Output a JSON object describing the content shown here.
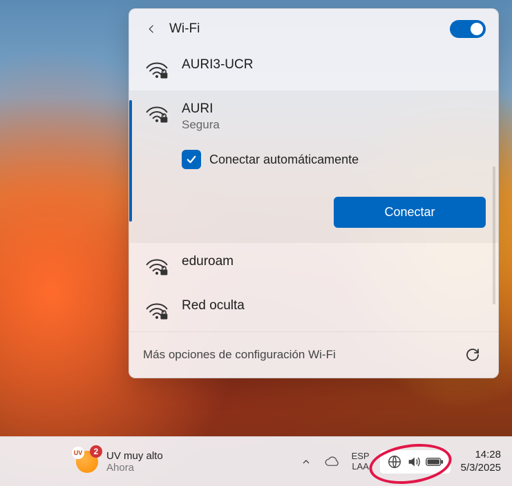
{
  "flyout": {
    "title": "Wi-Fi",
    "wifi_enabled": true,
    "more_settings": "Más opciones de configuración Wi-Fi",
    "networks": [
      {
        "ssid": "AURI3-UCR",
        "secure_icon": true
      },
      {
        "ssid": "AURI",
        "secure_icon": true,
        "selected": true,
        "status": "Segura",
        "auto_connect_label": "Conectar automáticamente",
        "auto_connect_checked": true,
        "connect_label": "Conectar"
      },
      {
        "ssid": "eduroam",
        "secure_icon": true
      },
      {
        "ssid": "Red oculta",
        "secure_icon": true
      }
    ]
  },
  "taskbar": {
    "weather": {
      "badge_text": "UV",
      "badge_count": "2",
      "headline": "UV muy alto",
      "subline": "Ahora"
    },
    "lang": {
      "line1": "ESP",
      "line2": "LAA"
    },
    "clock": {
      "time": "14:28",
      "date": "5/3/2025"
    }
  }
}
